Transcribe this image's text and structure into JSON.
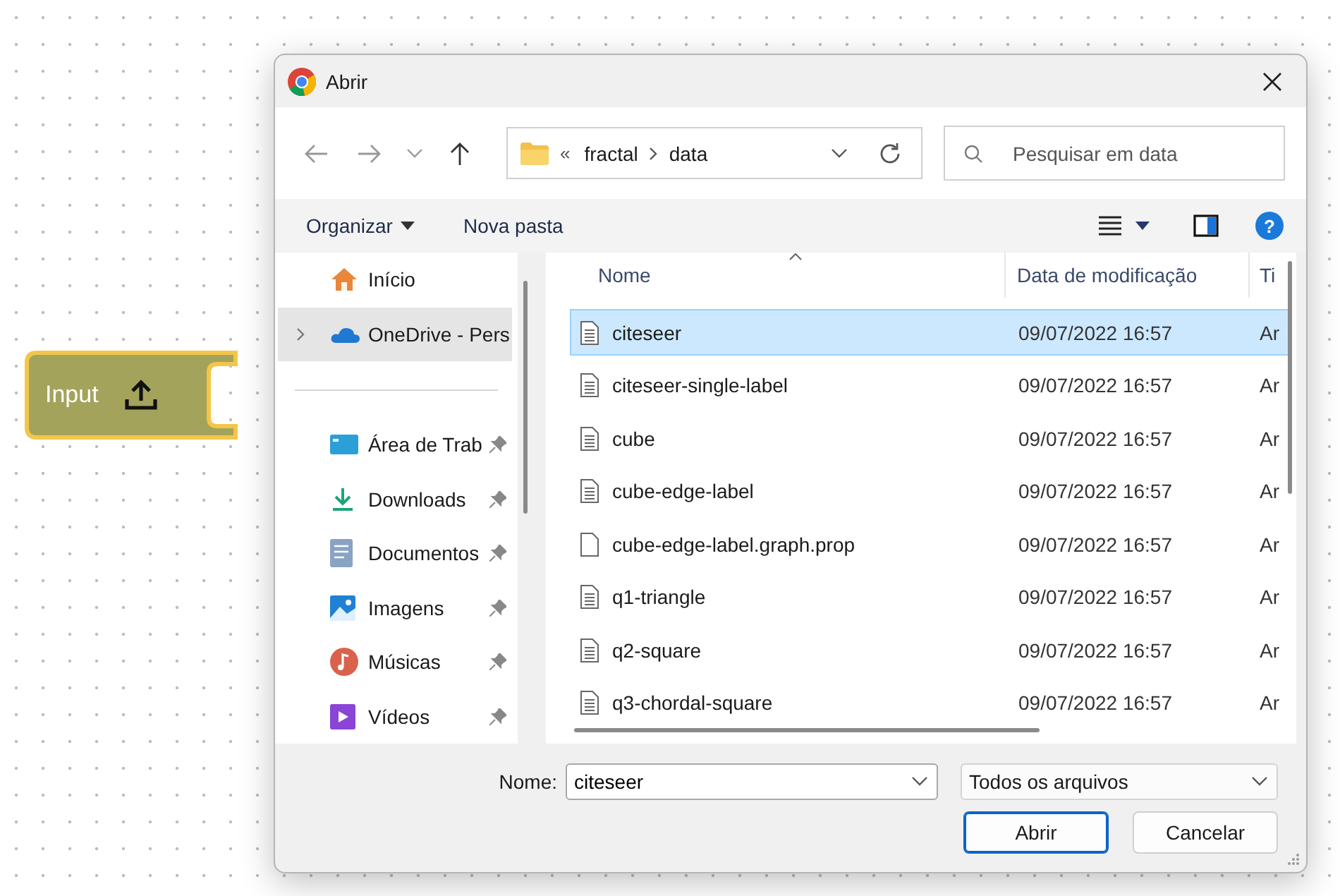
{
  "canvas": {
    "block": {
      "label": "Input"
    }
  },
  "dialog": {
    "title": "Abrir",
    "address": {
      "overflow": "«",
      "segments": [
        "fractal",
        "data"
      ]
    },
    "search": {
      "placeholder": "Pesquisar em data"
    },
    "toolbar": {
      "organize": "Organizar",
      "new_folder": "Nova pasta",
      "help": "?"
    },
    "sidebar": {
      "sections": [
        {
          "items": [
            {
              "label": "Início",
              "kind": "home",
              "selected": false,
              "expandable": false,
              "pinned": false
            },
            {
              "label": "OneDrive - Pers",
              "kind": "cloud",
              "selected": true,
              "expandable": true,
              "pinned": false
            }
          ]
        },
        {
          "items": [
            {
              "label": "Área de Trab",
              "kind": "desktop",
              "selected": false,
              "expandable": false,
              "pinned": true
            },
            {
              "label": "Downloads",
              "kind": "download",
              "selected": false,
              "expandable": false,
              "pinned": true
            },
            {
              "label": "Documentos",
              "kind": "document",
              "selected": false,
              "expandable": false,
              "pinned": true
            },
            {
              "label": "Imagens",
              "kind": "image",
              "selected": false,
              "expandable": false,
              "pinned": true
            },
            {
              "label": "Músicas",
              "kind": "music",
              "selected": false,
              "expandable": false,
              "pinned": true
            },
            {
              "label": "Vídeos",
              "kind": "video",
              "selected": false,
              "expandable": false,
              "pinned": true
            }
          ]
        }
      ]
    },
    "files": {
      "columns": [
        "Nome",
        "Data de modificação",
        "Ti"
      ],
      "rows": [
        {
          "name": "citeseer",
          "modified": "09/07/2022 16:57",
          "type": "Ar",
          "kind": "text",
          "selected": true
        },
        {
          "name": "citeseer-single-label",
          "modified": "09/07/2022 16:57",
          "type": "Ar",
          "kind": "text",
          "selected": false
        },
        {
          "name": "cube",
          "modified": "09/07/2022 16:57",
          "type": "Ar",
          "kind": "text",
          "selected": false
        },
        {
          "name": "cube-edge-label",
          "modified": "09/07/2022 16:57",
          "type": "Ar",
          "kind": "text",
          "selected": false
        },
        {
          "name": "cube-edge-label.graph.prop",
          "modified": "09/07/2022 16:57",
          "type": "Ar",
          "kind": "blank",
          "selected": false
        },
        {
          "name": "q1-triangle",
          "modified": "09/07/2022 16:57",
          "type": "Ar",
          "kind": "text",
          "selected": false
        },
        {
          "name": "q2-square",
          "modified": "09/07/2022 16:57",
          "type": "Ar",
          "kind": "text",
          "selected": false
        },
        {
          "name": "q3-chordal-square",
          "modified": "09/07/2022 16:57",
          "type": "Ar",
          "kind": "text",
          "selected": false
        }
      ]
    },
    "footer": {
      "name_label": "Nome:",
      "name_value": "citeseer",
      "filter": "Todos os arquivos",
      "buttons": [
        {
          "label": "Abrir",
          "default": true
        },
        {
          "label": "Cancelar",
          "default": false
        }
      ]
    }
  }
}
